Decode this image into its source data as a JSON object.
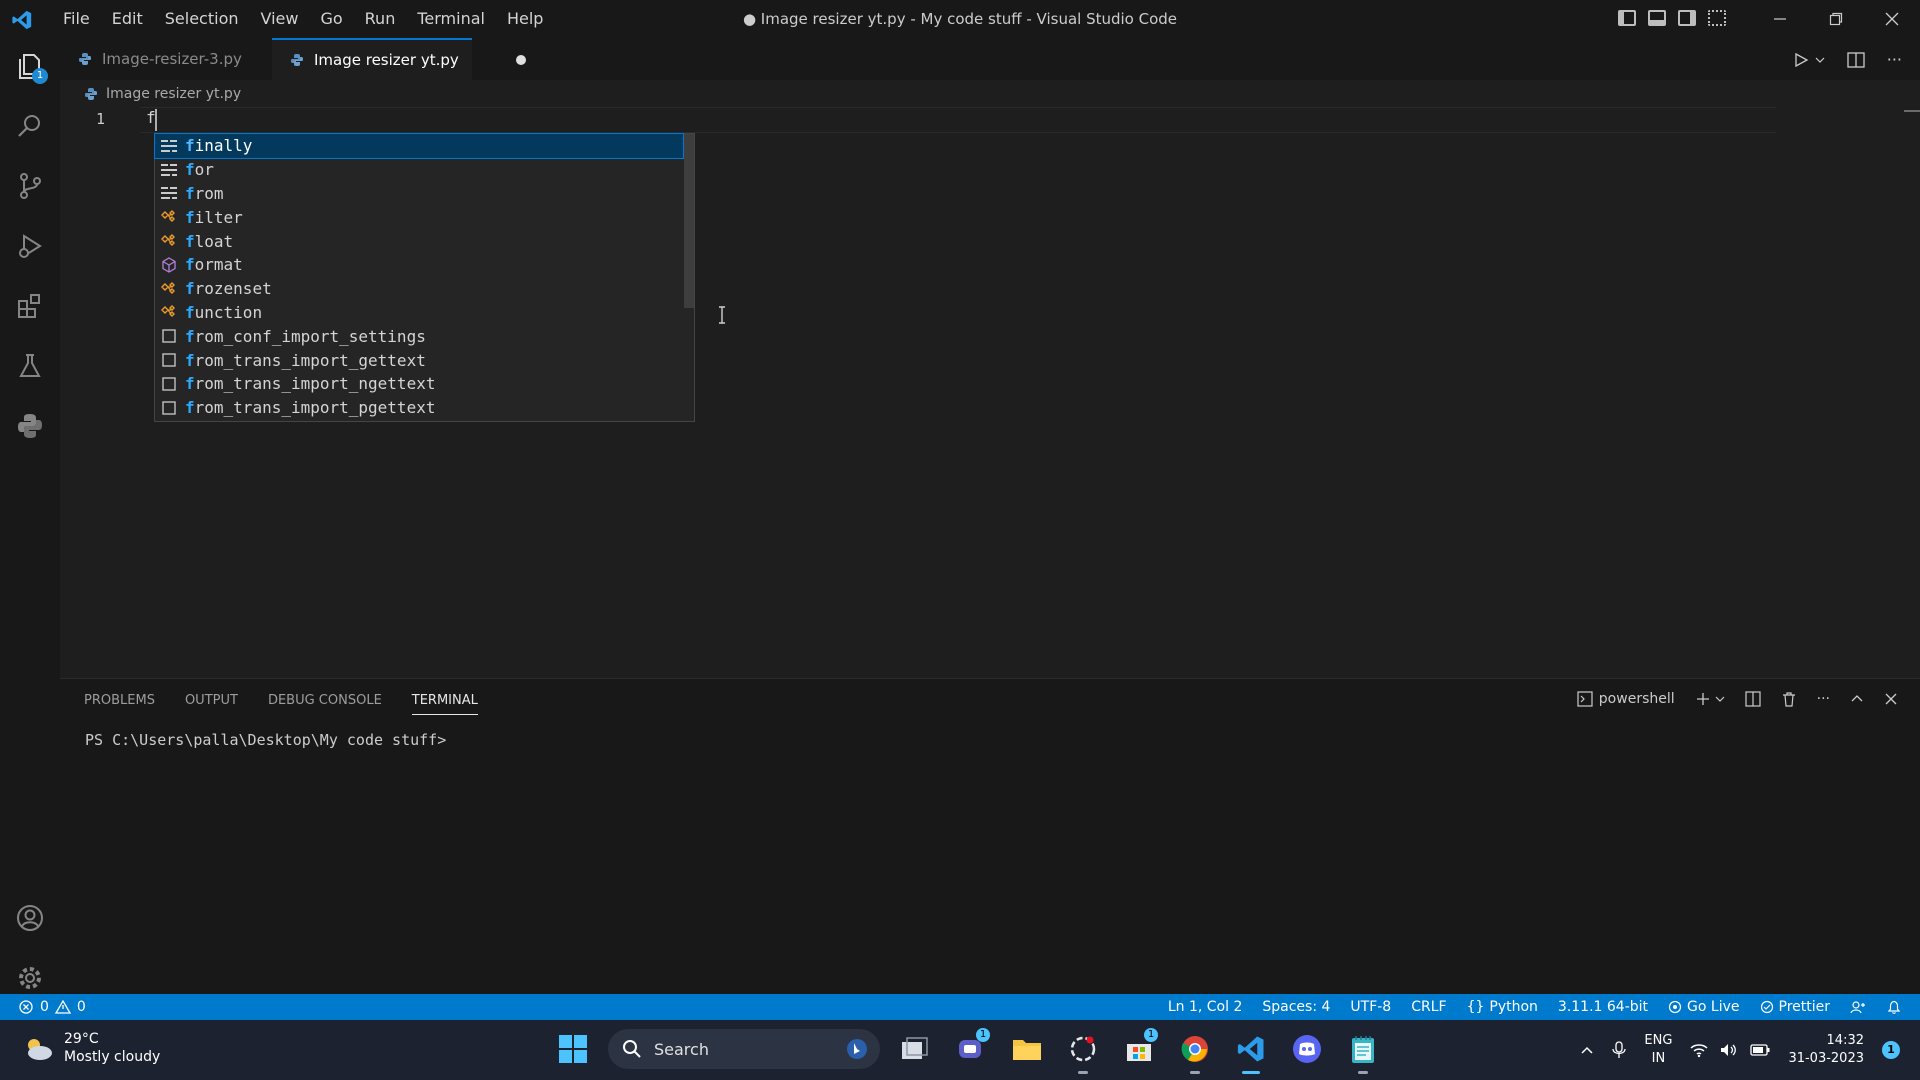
{
  "window": {
    "title": "● Image resizer yt.py - My code stuff - Visual Studio Code"
  },
  "menu": [
    "File",
    "Edit",
    "Selection",
    "View",
    "Go",
    "Run",
    "Terminal",
    "Help"
  ],
  "activity": {
    "explorer_badge": "1"
  },
  "tabs": [
    {
      "label": "Image-resizer-3.py"
    },
    {
      "label": "Image resizer yt.py",
      "dirty": true
    }
  ],
  "breadcrumb": {
    "file": "Image resizer yt.py"
  },
  "editor": {
    "line_number": "1",
    "typed": "f"
  },
  "suggestions": [
    {
      "match": "f",
      "rest": "inally",
      "kind": "keyword"
    },
    {
      "match": "f",
      "rest": "or",
      "kind": "keyword"
    },
    {
      "match": "f",
      "rest": "rom",
      "kind": "keyword"
    },
    {
      "match": "f",
      "rest": "ilter",
      "kind": "class"
    },
    {
      "match": "f",
      "rest": "loat",
      "kind": "class"
    },
    {
      "match": "f",
      "rest": "ormat",
      "kind": "function"
    },
    {
      "match": "f",
      "rest": "rozenset",
      "kind": "class"
    },
    {
      "match": "f",
      "rest": "unction",
      "kind": "class"
    },
    {
      "match": "f",
      "rest": "rom_conf_import_settings",
      "kind": "snippet"
    },
    {
      "match": "f",
      "rest": "rom_trans_import_gettext",
      "kind": "snippet"
    },
    {
      "match": "f",
      "rest": "rom_trans_import_ngettext",
      "kind": "snippet"
    },
    {
      "match": "f",
      "rest": "rom_trans_import_pgettext",
      "kind": "snippet"
    }
  ],
  "panel": {
    "tabs": [
      "PROBLEMS",
      "OUTPUT",
      "DEBUG CONSOLE",
      "TERMINAL"
    ],
    "active_tab": "TERMINAL",
    "shell": "powershell",
    "prompt": "PS C:\\Users\\palla\\Desktop\\My code stuff>"
  },
  "status": {
    "errors": "0",
    "warnings": "0",
    "position": "Ln 1, Col 2",
    "spaces": "Spaces: 4",
    "encoding": "UTF-8",
    "eol": "CRLF",
    "language": "Python",
    "interpreter": "3.11.1 64-bit",
    "go_live": "Go Live",
    "prettier": "Prettier"
  },
  "taskbar": {
    "temperature": "29°C",
    "weather": "Mostly cloudy",
    "search": "Search",
    "lang_top": "ENG",
    "lang_bottom": "IN",
    "time": "14:32",
    "date": "31-03-2023",
    "notification_count": "1",
    "teams_badge": "1",
    "store_badge": "1"
  },
  "colors": {
    "accent": "#007acc",
    "selection": "#04395e",
    "match": "#2aaaff",
    "keyword_icon": "#cccccc",
    "class_icon": "#ee9d28",
    "function_icon": "#b180d7"
  }
}
